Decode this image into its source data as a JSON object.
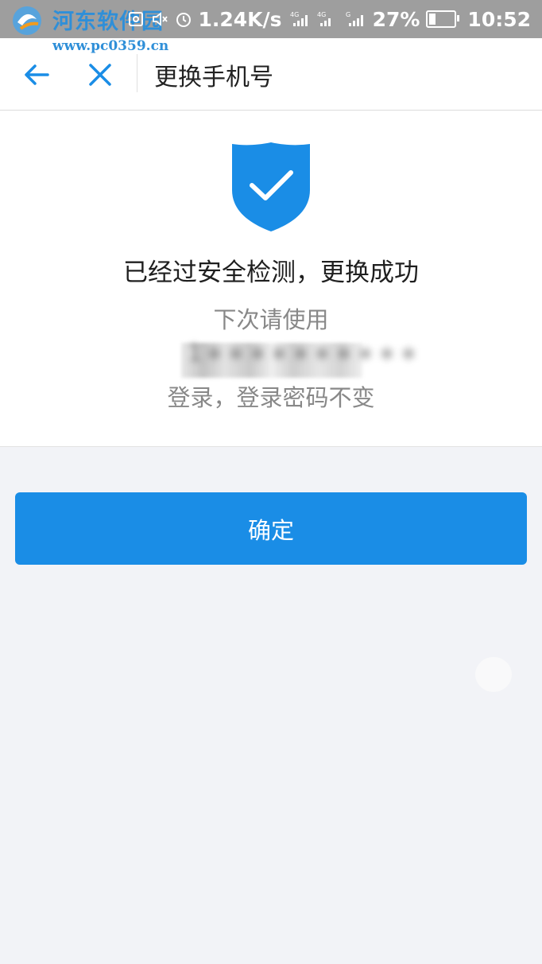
{
  "status_bar": {
    "watermark_title": "河东软件园",
    "watermark_url": "www.pc0359.cn",
    "network_speed": "1.24K/s",
    "battery": "27%",
    "battery_level": 0.27,
    "time": "10:52",
    "icons": [
      "nfc-icon",
      "mute-icon",
      "alarm-icon",
      "signal-4g-icon",
      "signal-4g-icon",
      "signal-icon"
    ]
  },
  "nav": {
    "title": "更换手机号",
    "back_icon": "arrow-left-icon",
    "close_icon": "close-icon"
  },
  "result": {
    "icon": "shield-check-icon",
    "message": "已经过安全检测，更换成功",
    "hint_line1": "下次请使用",
    "phone_masked": "1∗∗∗∗∗∗∗∗∗∗",
    "hint_line3": "登录，登录密码不变"
  },
  "actions": {
    "confirm_label": "确定"
  },
  "colors": {
    "accent": "#1a8de6",
    "status_bar": "#9e9e9e",
    "background": "#f2f3f7"
  }
}
